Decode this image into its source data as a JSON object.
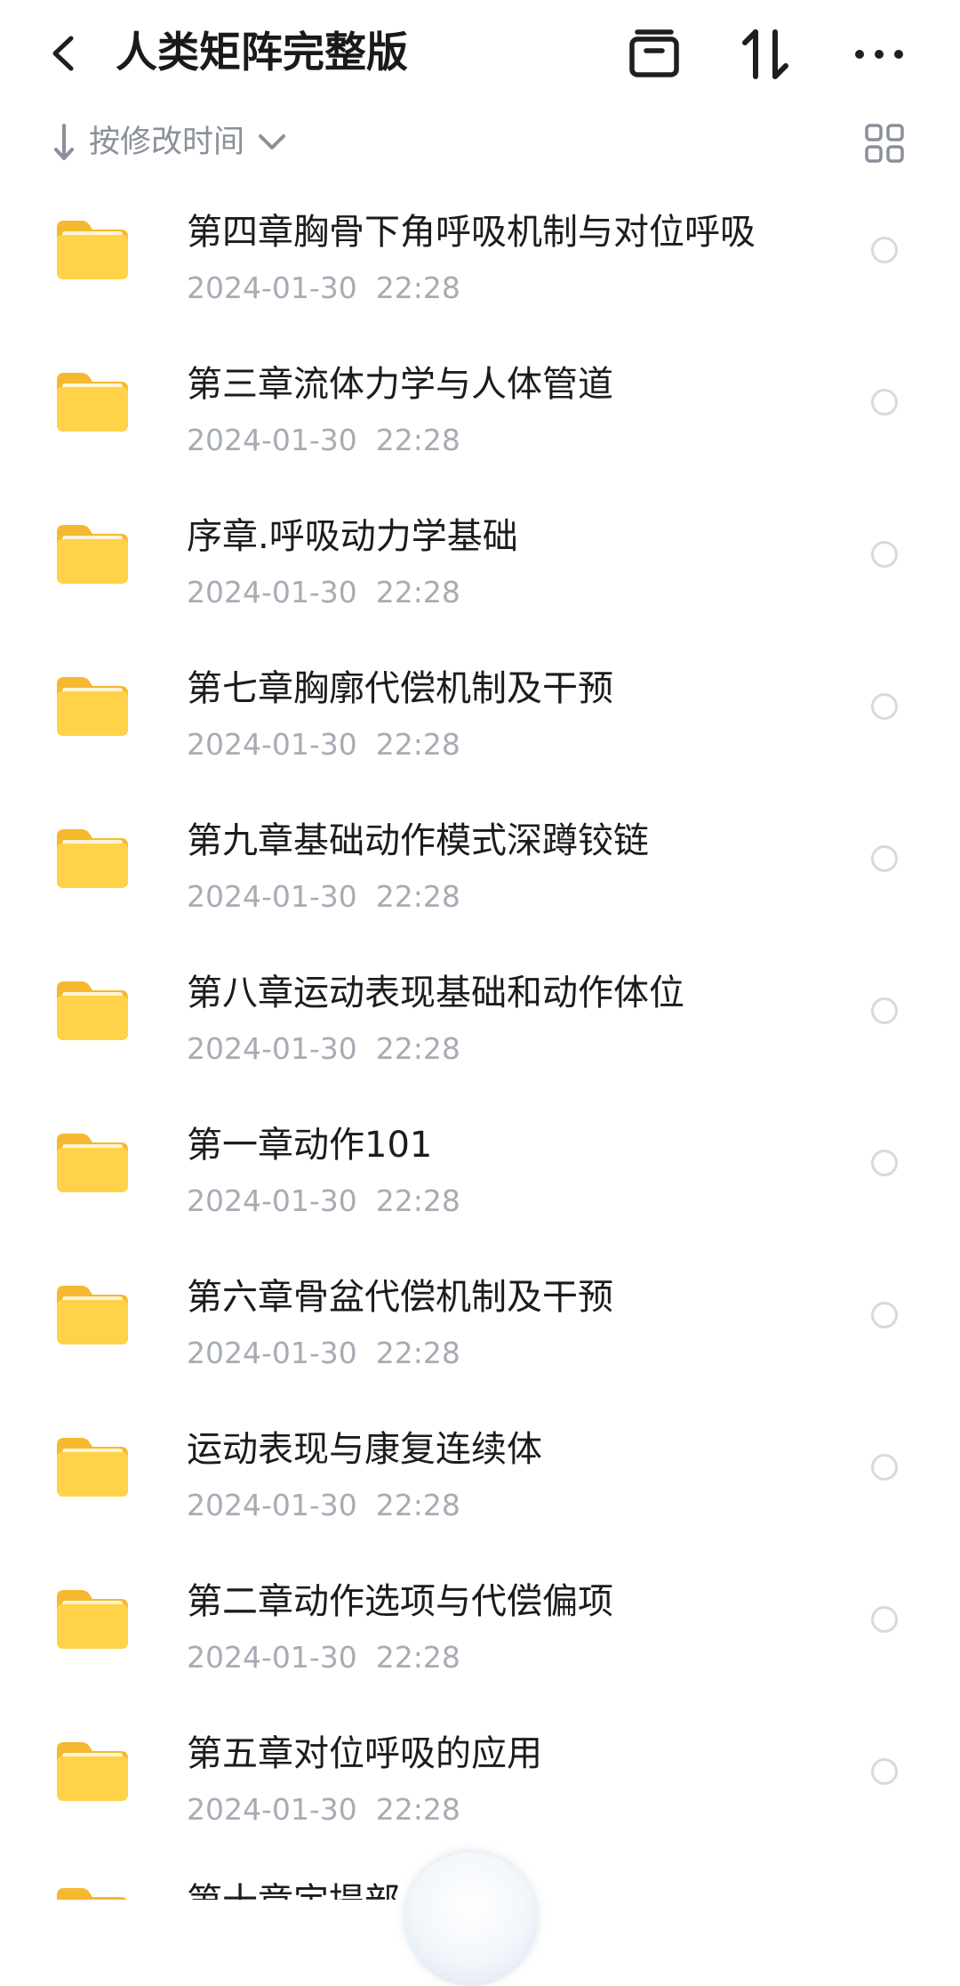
{
  "header": {
    "title": "人类矩阵完整版",
    "icons": [
      "back-icon",
      "collect-icon",
      "sort-icon",
      "more-icon"
    ]
  },
  "sortbar": {
    "label": "按修改时间",
    "icons": [
      "sort-down-arrow-icon",
      "chevron-down-icon",
      "grid-view-icon"
    ]
  },
  "colors": {
    "folder_yellow": "#FFD24A",
    "meta_gray": "#A7ACB4",
    "label_gray": "#8A909A"
  },
  "files": [
    {
      "name": "第四章胸骨下角呼吸机制与对位呼吸",
      "date": "2024-01-30",
      "time": "22:28"
    },
    {
      "name": "第三章流体力学与人体管道",
      "date": "2024-01-30",
      "time": "22:28"
    },
    {
      "name": "序章.呼吸动力学基础",
      "date": "2024-01-30",
      "time": "22:28"
    },
    {
      "name": "第七章胸廓代偿机制及干预",
      "date": "2024-01-30",
      "time": "22:28"
    },
    {
      "name": "第九章基础动作模式深蹲铰链",
      "date": "2024-01-30",
      "time": "22:28"
    },
    {
      "name": "第八章运动表现基础和动作体位",
      "date": "2024-01-30",
      "time": "22:28"
    },
    {
      "name": "第一章动作101",
      "date": "2024-01-30",
      "time": "22:28"
    },
    {
      "name": "第六章骨盆代偿机制及干预",
      "date": "2024-01-30",
      "time": "22:28"
    },
    {
      "name": "运动表现与康复连续体",
      "date": "2024-01-30",
      "time": "22:28"
    },
    {
      "name": "第二章动作选项与代偿偏项",
      "date": "2024-01-30",
      "time": "22:28"
    },
    {
      "name": "第五章对位呼吸的应用",
      "date": "2024-01-30",
      "time": "22:28"
    }
  ],
  "partial_row": {
    "name": "第十章定提部"
  }
}
